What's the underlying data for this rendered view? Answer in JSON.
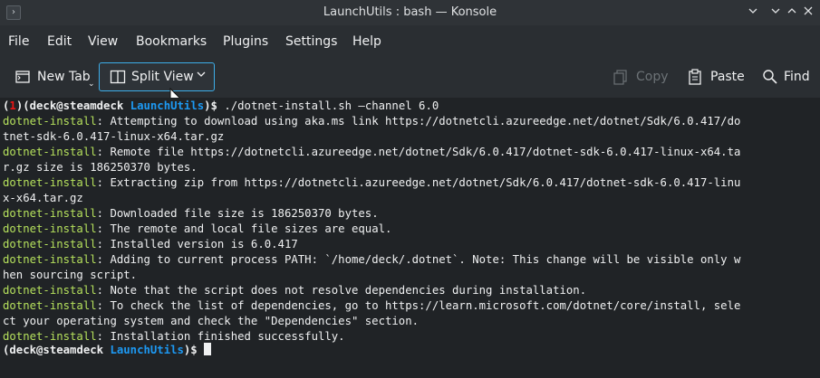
{
  "window": {
    "title": "LaunchUtils : bash — Konsole"
  },
  "menu": [
    "File",
    "Edit",
    "View",
    "Bookmarks",
    "Plugins",
    "Settings",
    "Help"
  ],
  "toolbar": {
    "new_tab": "New Tab",
    "split_view": "Split View",
    "copy": "Copy",
    "paste": "Paste",
    "find": "Find"
  },
  "terminal": {
    "prompt_user": "deck@steamdeck",
    "cwd": "LaunchUtils",
    "exit_code": "1",
    "command": "./dotnet-install.sh –channel 6.0",
    "lines": [
      [
        "dotnet-install",
        ": Attempting to download using aka.ms link https://dotnetcli.azureedge.net/dotnet/Sdk/6.0.417/do"
      ],
      [
        "",
        "tnet-sdk-6.0.417-linux-x64.tar.gz"
      ],
      [
        "dotnet-install",
        ": Remote file https://dotnetcli.azureedge.net/dotnet/Sdk/6.0.417/dotnet-sdk-6.0.417-linux-x64.ta"
      ],
      [
        "",
        "r.gz size is 186250370 bytes."
      ],
      [
        "dotnet-install",
        ": Extracting zip from https://dotnetcli.azureedge.net/dotnet/Sdk/6.0.417/dotnet-sdk-6.0.417-linu"
      ],
      [
        "",
        "x-x64.tar.gz"
      ],
      [
        "dotnet-install",
        ": Downloaded file size is 186250370 bytes."
      ],
      [
        "dotnet-install",
        ": The remote and local file sizes are equal."
      ],
      [
        "dotnet-install",
        ": Installed version is 6.0.417"
      ],
      [
        "dotnet-install",
        ": Adding to current process PATH: `/home/deck/.dotnet`. Note: This change will be visible only w"
      ],
      [
        "",
        "hen sourcing script."
      ],
      [
        "dotnet-install",
        ": Note that the script does not resolve dependencies during installation."
      ],
      [
        "dotnet-install",
        ": To check the list of dependencies, go to https://learn.microsoft.com/dotnet/core/install, sele"
      ],
      [
        "",
        "ct your operating system and check the \"Dependencies\" section."
      ],
      [
        "dotnet-install",
        ": Installation finished successfully."
      ]
    ]
  },
  "colors": {
    "accent": "#3daee9",
    "prompt_blue": "#1d99f3",
    "prefix_green": "#b5e05c",
    "error_red": "#ed1515"
  }
}
